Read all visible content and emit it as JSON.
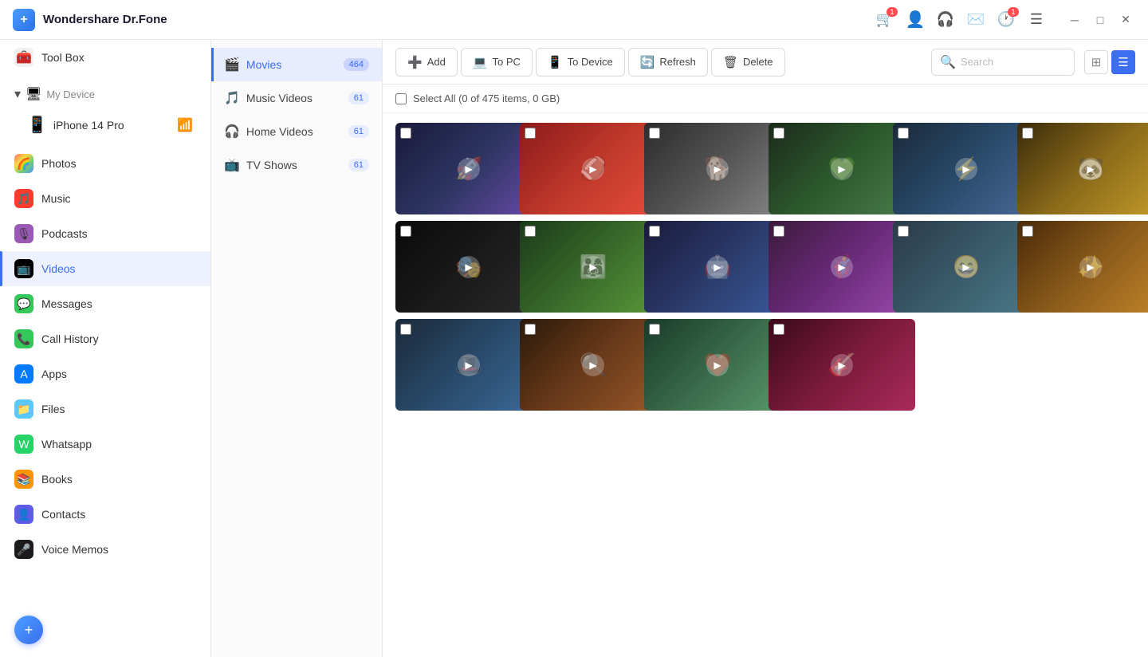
{
  "app": {
    "title": "Wondershare Dr.Fone"
  },
  "titlebar": {
    "icons": [
      "cart",
      "user",
      "headset",
      "mail",
      "clock",
      "list"
    ],
    "cart_badge": "1",
    "clock_badge": "1",
    "window_controls": [
      "minimize",
      "maximize",
      "close"
    ]
  },
  "sidebar": {
    "sections": [
      {
        "items": [
          {
            "id": "toolbox",
            "label": "Tool Box",
            "icon": "🧰",
            "iconClass": "icon-toolbox"
          }
        ]
      },
      {
        "header": "My Device",
        "device": "iPhone 14 Pro",
        "items": [
          {
            "id": "photos",
            "label": "Photos",
            "icon": "🌈",
            "iconClass": "icon-photos"
          },
          {
            "id": "music",
            "label": "Music",
            "icon": "♪",
            "iconClass": "icon-music"
          },
          {
            "id": "podcasts",
            "label": "Podcasts",
            "icon": "🎙",
            "iconClass": "icon-podcasts"
          },
          {
            "id": "videos",
            "label": "Videos",
            "icon": "📺",
            "iconClass": "icon-videos",
            "active": true
          },
          {
            "id": "messages",
            "label": "Messages",
            "icon": "💬",
            "iconClass": "icon-messages"
          },
          {
            "id": "callhistory",
            "label": "Call History",
            "icon": "📞",
            "iconClass": "icon-callhistory"
          },
          {
            "id": "apps",
            "label": "Apps",
            "icon": "🅐",
            "iconClass": "icon-apps"
          },
          {
            "id": "files",
            "label": "Files",
            "icon": "📁",
            "iconClass": "icon-files"
          },
          {
            "id": "whatsapp",
            "label": "Whatsapp",
            "icon": "💚",
            "iconClass": "icon-whatsapp"
          },
          {
            "id": "books",
            "label": "Books",
            "icon": "📚",
            "iconClass": "icon-books"
          },
          {
            "id": "contacts",
            "label": "Contacts",
            "icon": "👤",
            "iconClass": "icon-contacts"
          },
          {
            "id": "voicememos",
            "label": "Voice Memos",
            "icon": "🎵",
            "iconClass": "icon-voicememos"
          }
        ]
      }
    ]
  },
  "subnav": {
    "items": [
      {
        "id": "movies",
        "label": "Movies",
        "icon": "🎬",
        "count": "464",
        "active": true
      },
      {
        "id": "musicvideos",
        "label": "Music Videos",
        "icon": "🎵",
        "count": "61"
      },
      {
        "id": "homevideos",
        "label": "Home Videos",
        "icon": "🎧",
        "count": "61"
      },
      {
        "id": "tvshows",
        "label": "TV Shows",
        "icon": "📺",
        "count": "61"
      }
    ]
  },
  "toolbar": {
    "add_label": "Add",
    "topc_label": "To PC",
    "todevice_label": "To Device",
    "refresh_label": "Refresh",
    "delete_label": "Delete",
    "search_placeholder": "Search"
  },
  "selectbar": {
    "label": "Select All (0 of 475 items, 0 GB)"
  },
  "videos": [
    {
      "id": 1,
      "colorClass": "vt-1"
    },
    {
      "id": 2,
      "colorClass": "vt-2"
    },
    {
      "id": 3,
      "colorClass": "vt-3"
    },
    {
      "id": 4,
      "colorClass": "vt-4"
    },
    {
      "id": 5,
      "colorClass": "vt-5"
    },
    {
      "id": 6,
      "colorClass": "vt-6"
    },
    {
      "id": 7,
      "colorClass": "vt-7"
    },
    {
      "id": 8,
      "colorClass": "vt-8"
    },
    {
      "id": 9,
      "colorClass": "vt-9"
    },
    {
      "id": 10,
      "colorClass": "vt-10"
    },
    {
      "id": 11,
      "colorClass": "vt-11"
    },
    {
      "id": 12,
      "colorClass": "vt-12"
    },
    {
      "id": 13,
      "colorClass": "vt-13"
    },
    {
      "id": 14,
      "colorClass": "vt-14"
    },
    {
      "id": 15,
      "colorClass": "vt-15"
    },
    {
      "id": 16,
      "colorClass": "vt-16"
    }
  ]
}
